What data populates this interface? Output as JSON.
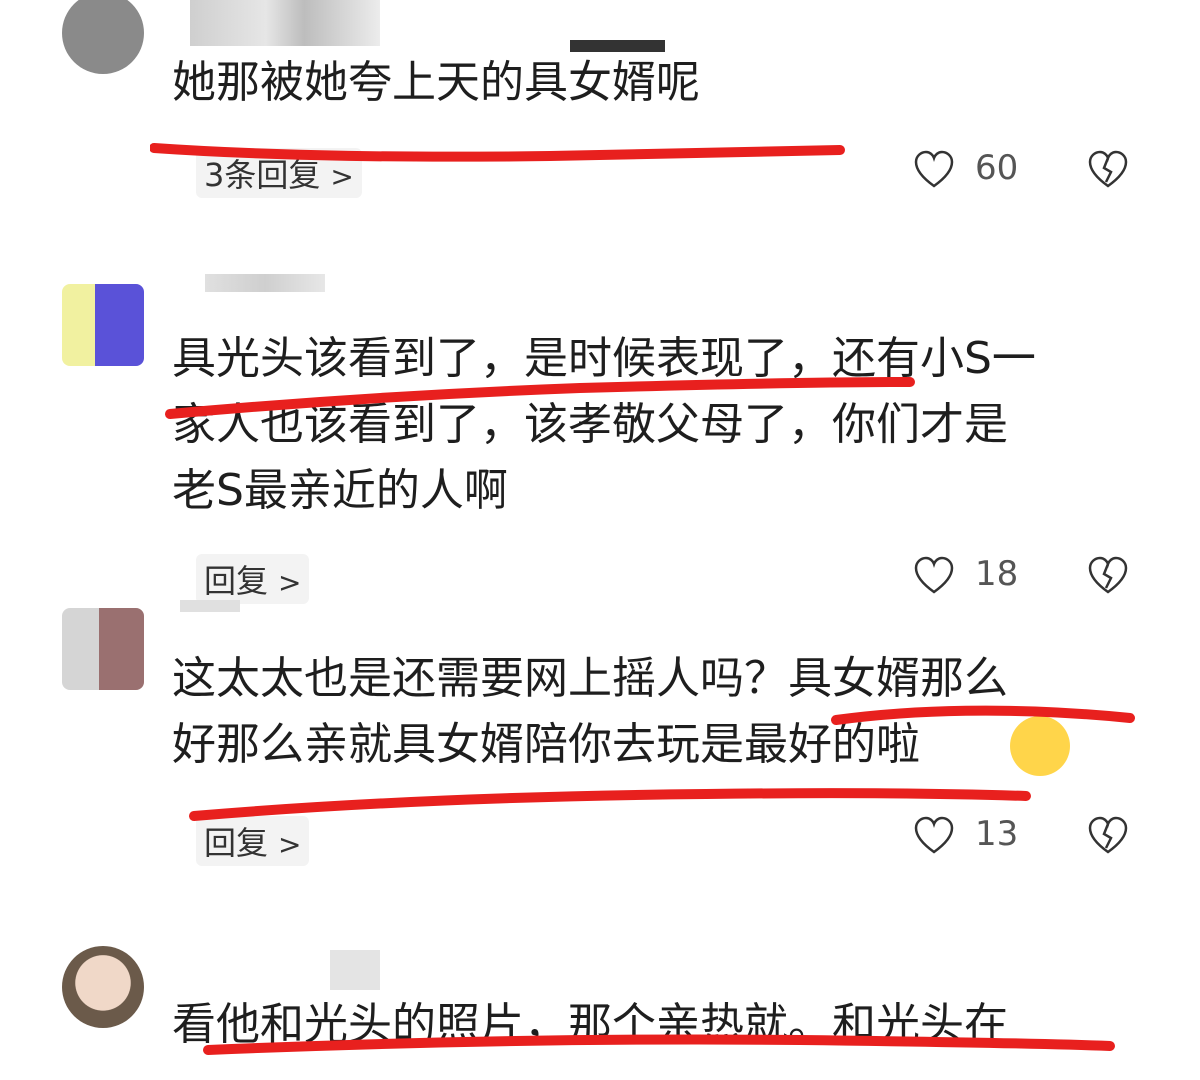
{
  "comments": [
    {
      "text": "她那被她夸上天的具女婿呢",
      "reply_label": "3条回复",
      "like_count": "60"
    },
    {
      "text": "具光头该看到了，是时候表现了，还有小S一\n家人也该看到了，该孝敬父母了，你们才是\n老S最亲近的人啊",
      "reply_label": "回复",
      "like_count": "18"
    },
    {
      "text": "这太太也是还需要网上摇人吗？具女婿那么\n好那么亲就具女婿陪你去玩是最好的啦",
      "reply_label": "回复",
      "like_count": "13"
    },
    {
      "text": "看他和光头的照片，那个亲热就。和光头在"
    }
  ],
  "icons": {
    "like": "heart-outline-icon",
    "dislike": "broken-heart-icon",
    "chevron": "chevron-right-icon"
  },
  "colors": {
    "highlight_underline": "#e8201e",
    "text": "#1e1e1e",
    "secondary": "#555555"
  }
}
